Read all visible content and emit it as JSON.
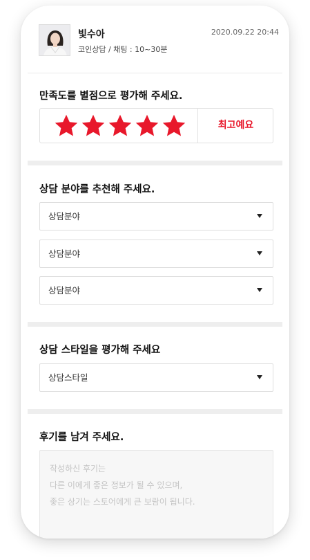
{
  "counselor": {
    "name": "빛수아",
    "info": "코인상담 / 채팅 : 10~30분",
    "date": "2020.09.22 20:44"
  },
  "rating": {
    "title": "만족도를 별점으로 평가해 주세요.",
    "stars_filled": 5,
    "stars_total": 5,
    "label": "최고예요",
    "star_color": "#e8182b",
    "label_color": "#e8182b"
  },
  "category": {
    "title": "상담 분야를 추천해 주세요.",
    "selects": [
      {
        "value": "상담분야"
      },
      {
        "value": "상담분야"
      },
      {
        "value": "상담분야"
      }
    ]
  },
  "style": {
    "title": "상담 스타일을 평가해 주세요",
    "select_value": "상담스타일"
  },
  "review": {
    "title": "후기를 남겨 주세요.",
    "placeholder": "작성하신 후기는\n다른 이에게 좋은 정보가 될 수 있으며,\n좋은 상기는 스토어에게 큰 보람이 됩니다."
  },
  "icons": {
    "star": "star-icon",
    "dropdown": "caret-down-icon",
    "avatar": "person-avatar"
  }
}
